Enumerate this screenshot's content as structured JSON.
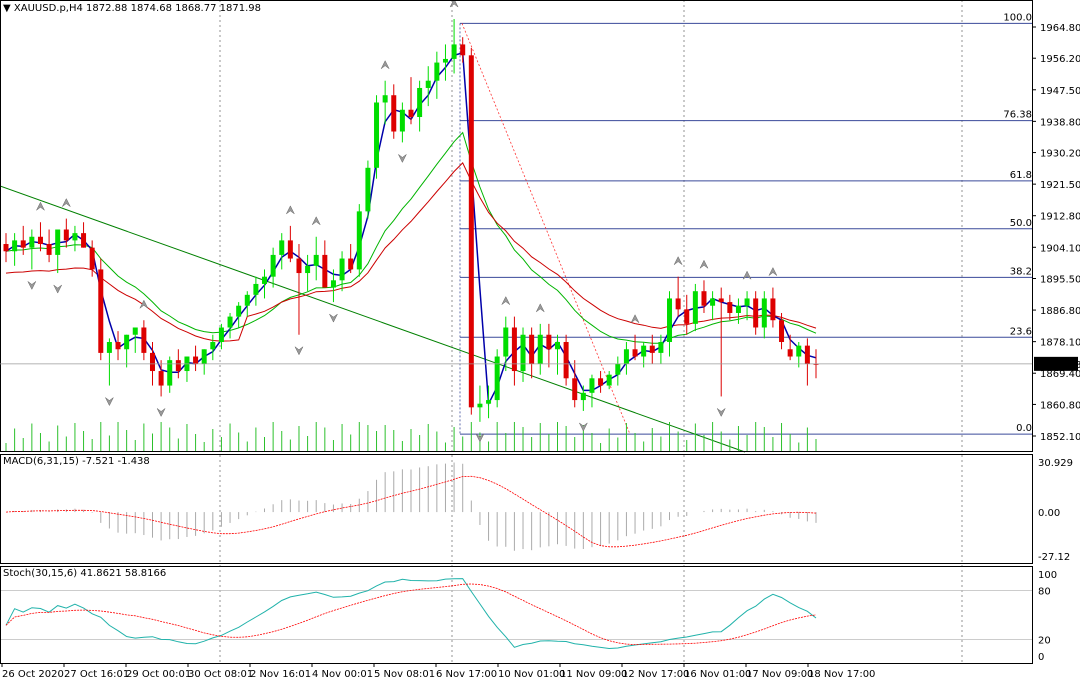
{
  "header": {
    "symbol": "XAUUSD.p,H4",
    "ohlc": "1872.88 1874.68 1868.77 1871.98",
    "macd_label": "MACD(6,31,15) -7.521 -1.438",
    "stoch_label": "Stoch(30,15,6) 41.8621 58.8166"
  },
  "chart_data": {
    "type": "candlestick",
    "symbol": "XAUUSD.p",
    "timeframe": "H4",
    "last_price": "1871.98",
    "price_ticks": [
      "1964.80",
      "1956.20",
      "1947.50",
      "1938.80",
      "1930.20",
      "1921.50",
      "1912.80",
      "1904.10",
      "1895.50",
      "1886.80",
      "1878.10",
      "1869.40",
      "1860.80",
      "1852.10"
    ],
    "time_labels": [
      "26 Oct 2020",
      "27 Oct 16:01",
      "29 Oct 00:01",
      "30 Oct 08:01",
      "2 Nov 16:01",
      "4 Nov 00:01",
      "5 Nov 08:01",
      "6 Nov 17:00",
      "10 Nov 01:00",
      "11 Nov 09:00",
      "12 Nov 17:00",
      "16 Nov 01:00",
      "17 Nov 09:00",
      "18 Nov 17:00"
    ],
    "fib_levels": [
      {
        "label": "100.0",
        "price": 1965.8
      },
      {
        "label": "76.38",
        "price": 1939.0
      },
      {
        "label": "61.8",
        "price": 1922.4
      },
      {
        "label": "50.0",
        "price": 1909.2
      },
      {
        "label": "38.2",
        "price": 1895.8
      },
      {
        "label": "23.6",
        "price": 1879.3
      },
      {
        "label": "0.0",
        "price": 1852.6
      }
    ],
    "candles": [
      [
        1905,
        1908,
        1900,
        1903
      ],
      [
        1903,
        1908,
        1899,
        1906
      ],
      [
        1906,
        1910,
        1902,
        1904
      ],
      [
        1904,
        1909,
        1898,
        1907
      ],
      [
        1907,
        1911,
        1903,
        1905
      ],
      [
        1905,
        1909,
        1900,
        1902
      ],
      [
        1902,
        1906,
        1897,
        1909
      ],
      [
        1909,
        1912,
        1904,
        1906
      ],
      [
        1906,
        1910,
        1903,
        1908
      ],
      [
        1908,
        1911,
        1904,
        1904
      ],
      [
        1904,
        1906,
        1896,
        1898
      ],
      [
        1898,
        1901,
        1873,
        1875
      ],
      [
        1875,
        1879,
        1866,
        1878
      ],
      [
        1878,
        1881,
        1873,
        1876
      ],
      [
        1876,
        1880,
        1871,
        1880
      ],
      [
        1880,
        1882,
        1875,
        1882
      ],
      [
        1882,
        1884,
        1873,
        1875
      ],
      [
        1875,
        1878,
        1866,
        1870
      ],
      [
        1870,
        1873,
        1863,
        1866
      ],
      [
        1866,
        1874,
        1864,
        1873
      ],
      [
        1873,
        1876,
        1868,
        1870
      ],
      [
        1870,
        1874,
        1867,
        1874
      ],
      [
        1874,
        1877,
        1870,
        1872
      ],
      [
        1872,
        1876,
        1869,
        1876
      ],
      [
        1876,
        1880,
        1873,
        1878
      ],
      [
        1878,
        1883,
        1876,
        1882
      ],
      [
        1882,
        1886,
        1879,
        1885
      ],
      [
        1885,
        1889,
        1882,
        1888
      ],
      [
        1888,
        1892,
        1885,
        1891
      ],
      [
        1891,
        1896,
        1888,
        1894
      ],
      [
        1894,
        1898,
        1890,
        1896
      ],
      [
        1896,
        1904,
        1893,
        1902
      ],
      [
        1902,
        1908,
        1898,
        1906
      ],
      [
        1906,
        1910,
        1900,
        1901
      ],
      [
        1901,
        1905,
        1880,
        1897
      ],
      [
        1897,
        1902,
        1892,
        1899
      ],
      [
        1899,
        1907,
        1895,
        1902
      ],
      [
        1902,
        1906,
        1896,
        1893
      ],
      [
        1893,
        1898,
        1889,
        1895
      ],
      [
        1895,
        1903,
        1892,
        1901
      ],
      [
        1901,
        1905,
        1897,
        1898
      ],
      [
        1898,
        1916,
        1896,
        1914
      ],
      [
        1914,
        1928,
        1912,
        1926
      ],
      [
        1926,
        1946,
        1923,
        1944
      ],
      [
        1944,
        1950,
        1938,
        1946
      ],
      [
        1946,
        1949,
        1934,
        1936
      ],
      [
        1936,
        1944,
        1933,
        1942
      ],
      [
        1942,
        1951,
        1938,
        1940
      ],
      [
        1940,
        1950,
        1936,
        1948
      ],
      [
        1948,
        1954,
        1943,
        1950
      ],
      [
        1950,
        1958,
        1945,
        1955
      ],
      [
        1955,
        1960,
        1950,
        1956
      ],
      [
        1956,
        1967,
        1952,
        1960
      ],
      [
        1960,
        1962,
        1955,
        1957
      ],
      [
        1957,
        1959,
        1858,
        1860
      ],
      [
        1860,
        1866,
        1856,
        1861
      ],
      [
        1861,
        1866,
        1857,
        1862
      ],
      [
        1862,
        1876,
        1860,
        1874
      ],
      [
        1874,
        1885,
        1870,
        1882
      ],
      [
        1882,
        1885,
        1866,
        1870
      ],
      [
        1870,
        1882,
        1867,
        1880
      ],
      [
        1880,
        1882,
        1868,
        1872
      ],
      [
        1872,
        1883,
        1869,
        1880
      ],
      [
        1880,
        1883,
        1871,
        1876
      ],
      [
        1876,
        1880,
        1869,
        1878
      ],
      [
        1878,
        1880,
        1866,
        1868
      ],
      [
        1868,
        1873,
        1860,
        1862
      ],
      [
        1862,
        1866,
        1859,
        1864
      ],
      [
        1864,
        1869,
        1860,
        1868
      ],
      [
        1868,
        1870,
        1864,
        1866
      ],
      [
        1866,
        1870,
        1865,
        1869
      ],
      [
        1869,
        1874,
        1866,
        1872
      ],
      [
        1872,
        1878,
        1869,
        1876
      ],
      [
        1876,
        1880,
        1873,
        1874
      ],
      [
        1874,
        1878,
        1871,
        1877
      ],
      [
        1877,
        1880,
        1872,
        1875
      ],
      [
        1875,
        1880,
        1872,
        1878
      ],
      [
        1878,
        1892,
        1874,
        1890
      ],
      [
        1890,
        1896,
        1885,
        1887
      ],
      [
        1887,
        1891,
        1880,
        1883
      ],
      [
        1883,
        1894,
        1881,
        1892
      ],
      [
        1892,
        1895,
        1886,
        1888
      ],
      [
        1888,
        1892,
        1884,
        1890
      ],
      [
        1890,
        1893,
        1863,
        1889
      ],
      [
        1889,
        1891,
        1884,
        1886
      ],
      [
        1886,
        1890,
        1883,
        1888
      ],
      [
        1888,
        1892,
        1884,
        1890
      ],
      [
        1890,
        1892,
        1880,
        1882
      ],
      [
        1882,
        1892,
        1879,
        1890
      ],
      [
        1890,
        1893,
        1882,
        1884
      ],
      [
        1884,
        1886,
        1876,
        1878
      ],
      [
        1876,
        1880,
        1873,
        1874
      ],
      [
        1874,
        1878,
        1871,
        1877
      ],
      [
        1877,
        1879,
        1866,
        1872
      ],
      [
        1872,
        1876,
        1868,
        1871.98
      ]
    ],
    "macd": {
      "range": [
        -27.12,
        30.929
      ],
      "ticks": [
        "30.929",
        "0.00",
        "-27.12"
      ]
    },
    "stochastic": {
      "range": [
        0,
        100
      ],
      "ticks": [
        "100",
        "80",
        "20",
        "0"
      ]
    },
    "colors": {
      "bull": "#00dd00",
      "bear": "#dd0000",
      "ma_fast": "#0000aa",
      "ma_mid": "#00b400",
      "ma_slow": "#cc0000",
      "fib": "#3a4a9a",
      "trend": "#008000"
    }
  }
}
